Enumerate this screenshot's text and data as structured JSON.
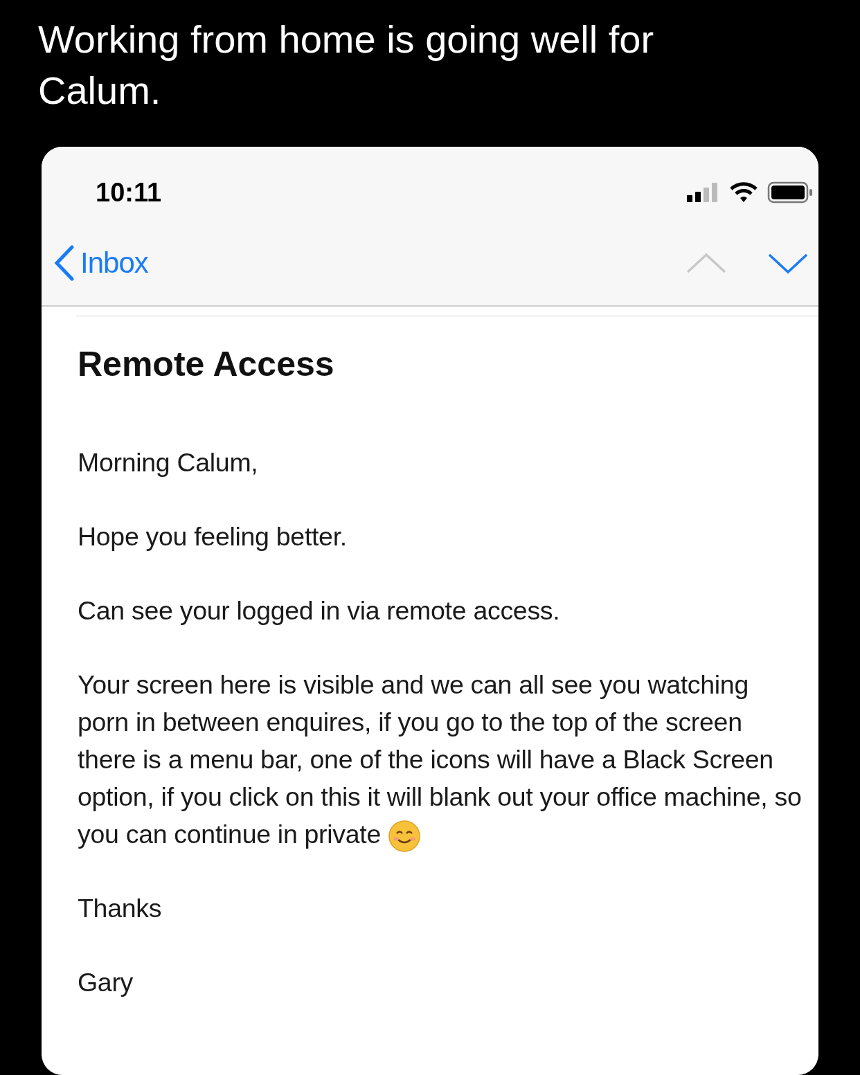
{
  "caption": "Working from home is going well for Calum.",
  "status_bar": {
    "time": "10:11"
  },
  "nav": {
    "back_label": "Inbox",
    "previous_disabled": true,
    "next_disabled": false
  },
  "email": {
    "subject": "Remote Access",
    "paragraphs": [
      {
        "text": "Morning Calum,",
        "ends_with_emoji": false
      },
      {
        "text": "Hope you feeling better.",
        "ends_with_emoji": false
      },
      {
        "text": "Can see your logged in via remote access.",
        "ends_with_emoji": false
      },
      {
        "text": "Your screen here is visible and we can all see you watching porn in between enquires, if you go to the top of the screen there is a menu bar, one of the icons will have a  Black Screen option, if you click on this it will blank out your office machine, so you can continue in private",
        "ends_with_emoji": true
      },
      {
        "text": "Thanks",
        "ends_with_emoji": false
      },
      {
        "text": "Gary",
        "ends_with_emoji": false
      }
    ]
  }
}
